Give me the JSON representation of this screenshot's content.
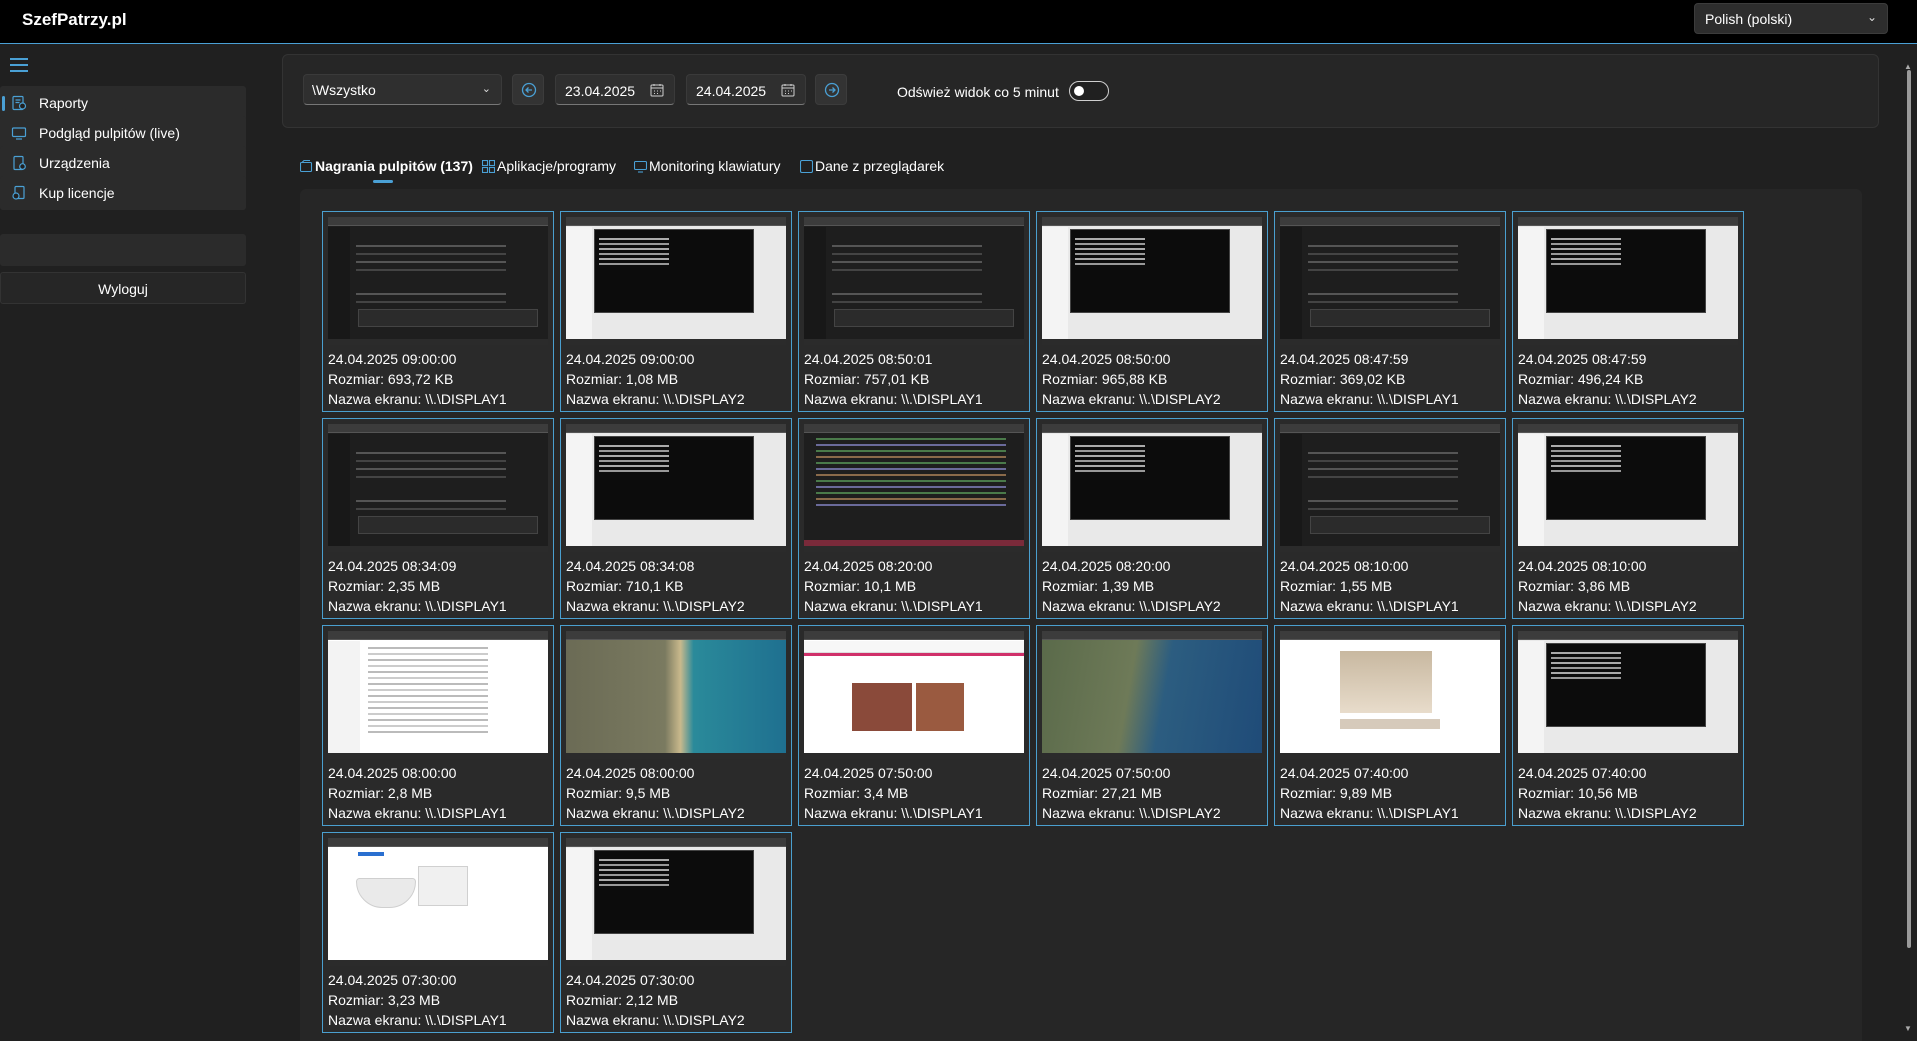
{
  "app": {
    "brand": "SzefPatrzy.pl"
  },
  "language": {
    "selected": "Polish (polski)"
  },
  "sidebar": {
    "items": [
      {
        "label": "Raporty",
        "icon": "report-icon",
        "active": true
      },
      {
        "label": "Podgląd pulpitów (live)",
        "icon": "monitor-icon",
        "active": false
      },
      {
        "label": "Urządzenia",
        "icon": "device-icon",
        "active": false
      },
      {
        "label": "Kup licencje",
        "icon": "license-icon",
        "active": false
      }
    ],
    "logout_label": "Wyloguj"
  },
  "filters": {
    "group": "\\Wszystko",
    "date_from": "23.04.2025",
    "date_to": "24.04.2025",
    "refresh_label": "Odśwież widok co 5 minut",
    "refresh_on": false
  },
  "tabs": [
    {
      "label": "Nagrania pulpitów (137)",
      "active": true,
      "icon": "screen-recording-icon"
    },
    {
      "label": "Aplikacje/programy",
      "active": false,
      "icon": "apps-icon"
    },
    {
      "label": "Monitoring klawiatury",
      "active": false,
      "icon": "keyboard-icon"
    },
    {
      "label": "Dane z przeglądarek",
      "active": false,
      "icon": "browser-icon"
    }
  ],
  "recordings": [
    {
      "time": "24.04.2025 09:00:00",
      "size": "Rozmiar: 693,72 KB",
      "screen": "Nazwa ekranu: \\\\.\\DISPLAY1",
      "thumb": "dark"
    },
    {
      "time": "24.04.2025 09:00:00",
      "size": "Rozmiar: 1,08 MB",
      "screen": "Nazwa ekranu: \\\\.\\DISPLAY2",
      "thumb": "term"
    },
    {
      "time": "24.04.2025 08:50:01",
      "size": "Rozmiar: 757,01 KB",
      "screen": "Nazwa ekranu: \\\\.\\DISPLAY1",
      "thumb": "dark"
    },
    {
      "time": "24.04.2025 08:50:00",
      "size": "Rozmiar: 965,88 KB",
      "screen": "Nazwa ekranu: \\\\.\\DISPLAY2",
      "thumb": "term"
    },
    {
      "time": "24.04.2025 08:47:59",
      "size": "Rozmiar: 369,02 KB",
      "screen": "Nazwa ekranu: \\\\.\\DISPLAY1",
      "thumb": "dark"
    },
    {
      "time": "24.04.2025 08:47:59",
      "size": "Rozmiar: 496,24 KB",
      "screen": "Nazwa ekranu: \\\\.\\DISPLAY2",
      "thumb": "term"
    },
    {
      "time": "24.04.2025 08:34:09",
      "size": "Rozmiar: 2,35 MB",
      "screen": "Nazwa ekranu: \\\\.\\DISPLAY1",
      "thumb": "dark"
    },
    {
      "time": "24.04.2025 08:34:08",
      "size": "Rozmiar: 710,1 KB",
      "screen": "Nazwa ekranu: \\\\.\\DISPLAY2",
      "thumb": "term"
    },
    {
      "time": "24.04.2025 08:20:00",
      "size": "Rozmiar: 10,1 MB",
      "screen": "Nazwa ekranu: \\\\.\\DISPLAY1",
      "thumb": "code"
    },
    {
      "time": "24.04.2025 08:20:00",
      "size": "Rozmiar: 1,39 MB",
      "screen": "Nazwa ekranu: \\\\.\\DISPLAY2",
      "thumb": "term"
    },
    {
      "time": "24.04.2025 08:10:00",
      "size": "Rozmiar: 1,55 MB",
      "screen": "Nazwa ekranu: \\\\.\\DISPLAY1",
      "thumb": "dark"
    },
    {
      "time": "24.04.2025 08:10:00",
      "size": "Rozmiar: 3,86 MB",
      "screen": "Nazwa ekranu: \\\\.\\DISPLAY2",
      "thumb": "term"
    },
    {
      "time": "24.04.2025 08:00:00",
      "size": "Rozmiar: 2,8 MB",
      "screen": "Nazwa ekranu: \\\\.\\DISPLAY1",
      "thumb": "doc"
    },
    {
      "time": "24.04.2025 08:00:00",
      "size": "Rozmiar: 9,5 MB",
      "screen": "Nazwa ekranu: \\\\.\\DISPLAY2",
      "thumb": "map"
    },
    {
      "time": "24.04.2025 07:50:00",
      "size": "Rozmiar: 3,4 MB",
      "screen": "Nazwa ekranu: \\\\.\\DISPLAY1",
      "thumb": "web"
    },
    {
      "time": "24.04.2025 07:50:00",
      "size": "Rozmiar: 27,21 MB",
      "screen": "Nazwa ekranu: \\\\.\\DISPLAY2",
      "thumb": "map2"
    },
    {
      "time": "24.04.2025 07:40:00",
      "size": "Rozmiar: 9,89 MB",
      "screen": "Nazwa ekranu: \\\\.\\DISPLAY1",
      "thumb": "room"
    },
    {
      "time": "24.04.2025 07:40:00",
      "size": "Rozmiar: 10,56 MB",
      "screen": "Nazwa ekranu: \\\\.\\DISPLAY2",
      "thumb": "term"
    },
    {
      "time": "24.04.2025 07:30:00",
      "size": "Rozmiar: 3,23 MB",
      "screen": "Nazwa ekranu: \\\\.\\DISPLAY1",
      "thumb": "shop"
    },
    {
      "time": "24.04.2025 07:30:00",
      "size": "Rozmiar: 2,12 MB",
      "screen": "Nazwa ekranu: \\\\.\\DISPLAY2",
      "thumb": "term"
    }
  ],
  "colors": {
    "accent": "#4aa0d5",
    "background": "#202020",
    "panel": "#262626"
  }
}
